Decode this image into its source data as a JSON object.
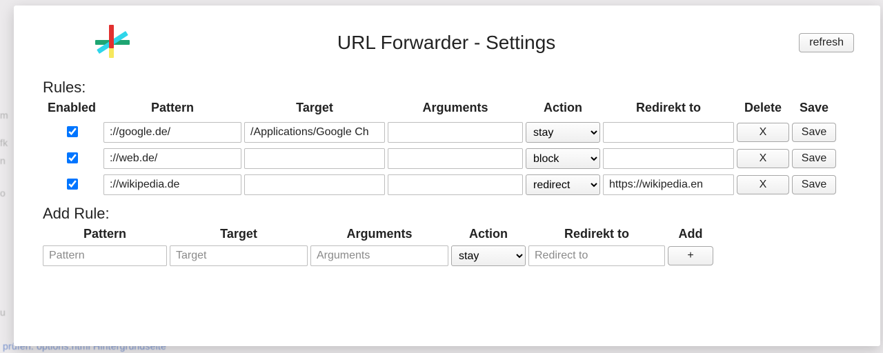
{
  "header": {
    "title": "URL Forwarder - Settings",
    "refresh_label": "refresh"
  },
  "rules": {
    "title": "Rules:",
    "cols": {
      "enabled": "Enabled",
      "pattern": "Pattern",
      "target": "Target",
      "arguments": "Arguments",
      "action": "Action",
      "redirect": "Redirekt to",
      "delete": "Delete",
      "save": "Save"
    },
    "action_options": [
      "stay",
      "block",
      "redirect"
    ],
    "items": [
      {
        "enabled": true,
        "pattern": "://google.de/",
        "target": "/Applications/Google Ch",
        "arguments": "",
        "action": "stay",
        "redirect": "",
        "delete_label": "X",
        "save_label": "Save"
      },
      {
        "enabled": true,
        "pattern": "://web.de/",
        "target": "",
        "arguments": "",
        "action": "block",
        "redirect": "",
        "delete_label": "X",
        "save_label": "Save"
      },
      {
        "enabled": true,
        "pattern": "://wikipedia.de",
        "target": "",
        "arguments": "",
        "action": "redirect",
        "redirect": "https://wikipedia.en",
        "delete_label": "X",
        "save_label": "Save"
      }
    ]
  },
  "add_rule": {
    "title": "Add Rule:",
    "cols": {
      "pattern": "Pattern",
      "target": "Target",
      "arguments": "Arguments",
      "action": "Action",
      "redirect": "Redirekt to",
      "add": "Add"
    },
    "placeholders": {
      "pattern": "Pattern",
      "target": "Target",
      "arguments": "Arguments",
      "redirect": "Redirect to"
    },
    "action": "stay",
    "add_label": "+"
  },
  "bg": {
    "bottom_links": "prüfen:   options.html   Hintergrundseite",
    "left1": "m",
    "left2": "fk",
    "left3": "n",
    "left4": "o",
    "left5": "u"
  }
}
